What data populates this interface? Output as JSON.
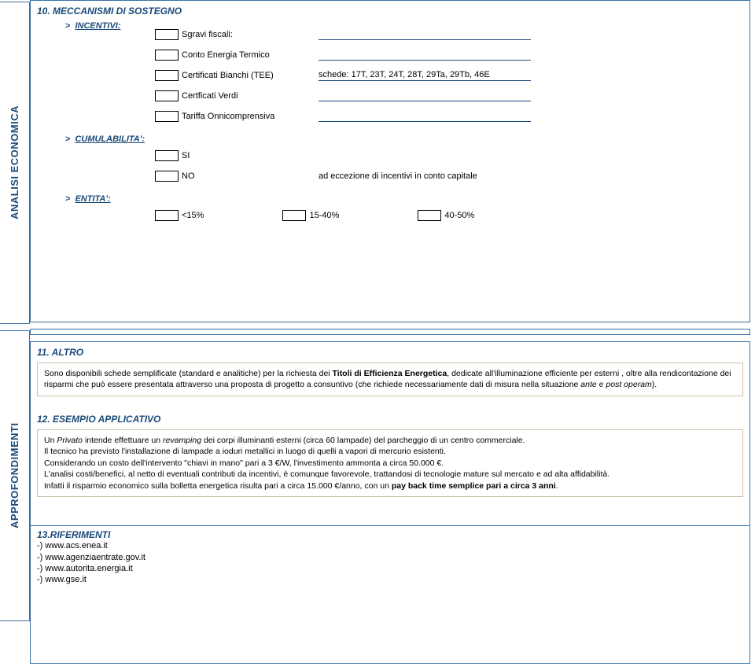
{
  "sidetabs": {
    "analisi": "ANALISI ECONOMICA",
    "approf": "APPROFONDIMENTI"
  },
  "sec10": {
    "title": "10. MECCANISMI DI SOSTEGNO",
    "incentivi_label": "INCENTIVI:",
    "fields": {
      "sgravi": "Sgravi fiscali:",
      "conto": "Conto Energia Termico",
      "certificati": "Certificati Bianchi (TEE)",
      "certficati_verdi": "Certficati Verdi",
      "tariffa": "Tariffa Onnicomprensiva"
    },
    "certificati_val": "schede: 17T, 23T, 24T, 28T, 29Ta, 29Tb, 46E",
    "cumulabilita_label": "CUMULABILITA':",
    "si": "SI",
    "no": "NO",
    "no_text": "ad eccezione di incentivi in conto capitale",
    "entita_label": "ENTITA':",
    "entita": {
      "a": "<15%",
      "b": "15-40%",
      "c": "40-50%"
    }
  },
  "sec11": {
    "title": "11. ALTRO",
    "body_html": "Sono disponibili schede semplificate (standard e analitiche) per la richiesta dei <strong class='b'>Titoli di Efficienza Energetica</strong>, dedicate all'illuminazione efficiente per esterni , oltre alla rendicontazione  dei risparmi che può essere presentata attraverso una proposta di progetto a consuntivo (che richiede necessariamente dati di misura nella situazione <em class='i'>ante</em> e <em class='i'>post operam</em>)."
  },
  "sec12": {
    "title": "12. ESEMPIO APPLICATIVO",
    "body_html": "Un <em class='i'>Privato</em> intende effettuare un <em class='i'>revamping</em> dei  corpi illuminanti esterni (circa 60 lampade) del parcheggio di un centro commerciale.\nIl tecnico ha previsto l'installazione di lampade a ioduri metallici in luogo di  quelli a vapori di mercurio esistenti.\nConsiderando  un costo dell'intervento \"chiavi in mano\" pari a 3 €/W, l'investimento ammonta a circa 50.000 €.\nL'analisi costi/benefici, al netto di eventuali contributi da incentivi, è comunque favorevole, trattandosi di tecnologie mature sul mercato e ad alta affidabilità.\nInfatti il risparmio economico sulla bolletta energetica risulta pari a circa 15.000 €/anno, con un  <strong class='b'>pay back time semplice pari a circa 3 anni</strong>."
  },
  "sec13": {
    "title": "13.RIFERIMENTI",
    "lines": [
      "-) www.acs.enea.it",
      "-) www.agenziaentrate.gov.it",
      "-) www.autorita.energia.it",
      "-) www.gse.it"
    ]
  }
}
